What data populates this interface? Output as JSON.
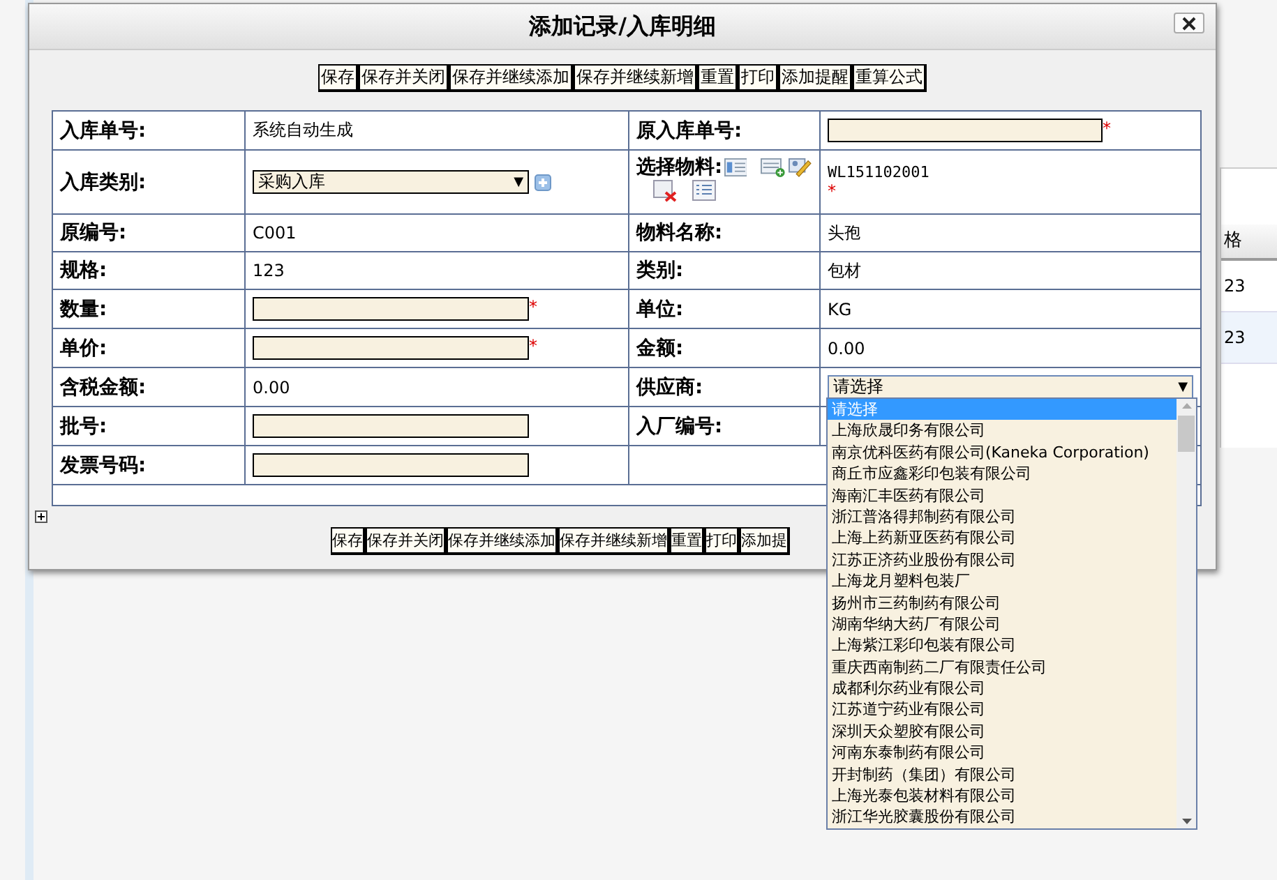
{
  "background": {
    "column_header": "格",
    "cells": [
      "23",
      "23"
    ]
  },
  "dialog": {
    "title": "添加记录/入库明细",
    "toolbar": [
      "保存",
      "保存并关闭",
      "保存并继续添加",
      "保存并继续新增",
      "重置",
      "打印",
      "添加提醒",
      "重算公式"
    ],
    "rows": [
      {
        "cells": [
          {
            "label": "入库单号:",
            "kind": "text",
            "value": "系统自动生成"
          },
          {
            "label": "原入库单号:",
            "kind": "input",
            "required_mark": "*"
          }
        ]
      },
      {
        "cells": [
          {
            "label": "入库类别:",
            "kind": "select",
            "value": "采购入库",
            "arrow": "▼"
          },
          {
            "label": "选择物料:",
            "kind": "material",
            "value": "WL151102001",
            "required_mark": "*"
          }
        ]
      },
      {
        "cells": [
          {
            "label": "原编号:",
            "kind": "text",
            "value": "C001"
          },
          {
            "label": "物料名称:",
            "kind": "text",
            "value": "头孢"
          }
        ]
      },
      {
        "cells": [
          {
            "label": "规格:",
            "kind": "text",
            "value": "123"
          },
          {
            "label": "类别:",
            "kind": "text",
            "value": "包材"
          }
        ]
      },
      {
        "cells": [
          {
            "label": "数量:",
            "kind": "input",
            "required_mark": "*"
          },
          {
            "label": "单位:",
            "kind": "text",
            "value": "KG"
          }
        ]
      },
      {
        "cells": [
          {
            "label": "单价:",
            "kind": "input",
            "required_mark": "*"
          },
          {
            "label": "金额:",
            "kind": "text",
            "value": "0.00"
          }
        ]
      },
      {
        "cells": [
          {
            "label": "含税金额:",
            "kind": "text",
            "value": "0.00"
          },
          {
            "label": "供应商:",
            "kind": "dropdown",
            "value": "请选择",
            "arrow": "▼"
          }
        ]
      },
      {
        "cells": [
          {
            "label": "批号:",
            "kind": "input"
          },
          {
            "label": "入厂编号:",
            "kind": "text"
          }
        ]
      },
      {
        "cells": [
          {
            "label": "发票号码:",
            "kind": "input"
          },
          {
            "kind": "empty"
          }
        ]
      }
    ],
    "bottom_toolbar": [
      "保存",
      "保存并关闭",
      "保存并继续添加",
      "保存并继续新增",
      "重置",
      "打印",
      "添加提"
    ]
  },
  "supplier_list": [
    {
      "label": "请选择",
      "selected": true
    },
    {
      "label": "上海欣晟印务有限公司",
      "selected": false
    },
    {
      "label": "南京优科医药有限公司(Kaneka Corporation)",
      "selected": false
    },
    {
      "label": "商丘市应鑫彩印包装有限公司",
      "selected": false
    },
    {
      "label": "海南汇丰医药有限公司",
      "selected": false
    },
    {
      "label": "浙江普洛得邦制药有限公司",
      "selected": false
    },
    {
      "label": "上海上药新亚医药有限公司",
      "selected": false
    },
    {
      "label": "江苏正济药业股份有限公司",
      "selected": false
    },
    {
      "label": "上海龙月塑料包装厂",
      "selected": false
    },
    {
      "label": "扬州市三药制药有限公司",
      "selected": false
    },
    {
      "label": "湖南华纳大药厂有限公司",
      "selected": false
    },
    {
      "label": "上海紫江彩印包装有限公司",
      "selected": false
    },
    {
      "label": "重庆西南制药二厂有限责任公司",
      "selected": false
    },
    {
      "label": "成都利尔药业有限公司",
      "selected": false
    },
    {
      "label": "江苏道宁药业有限公司",
      "selected": false
    },
    {
      "label": "深圳天众塑胶有限公司",
      "selected": false
    },
    {
      "label": "河南东泰制药有限公司",
      "selected": false
    },
    {
      "label": "开封制药（集团）有限公司",
      "selected": false
    },
    {
      "label": "上海光泰包装材料有限公司",
      "selected": false
    },
    {
      "label": "浙江华光胶囊股份有限公司",
      "selected": false
    }
  ]
}
